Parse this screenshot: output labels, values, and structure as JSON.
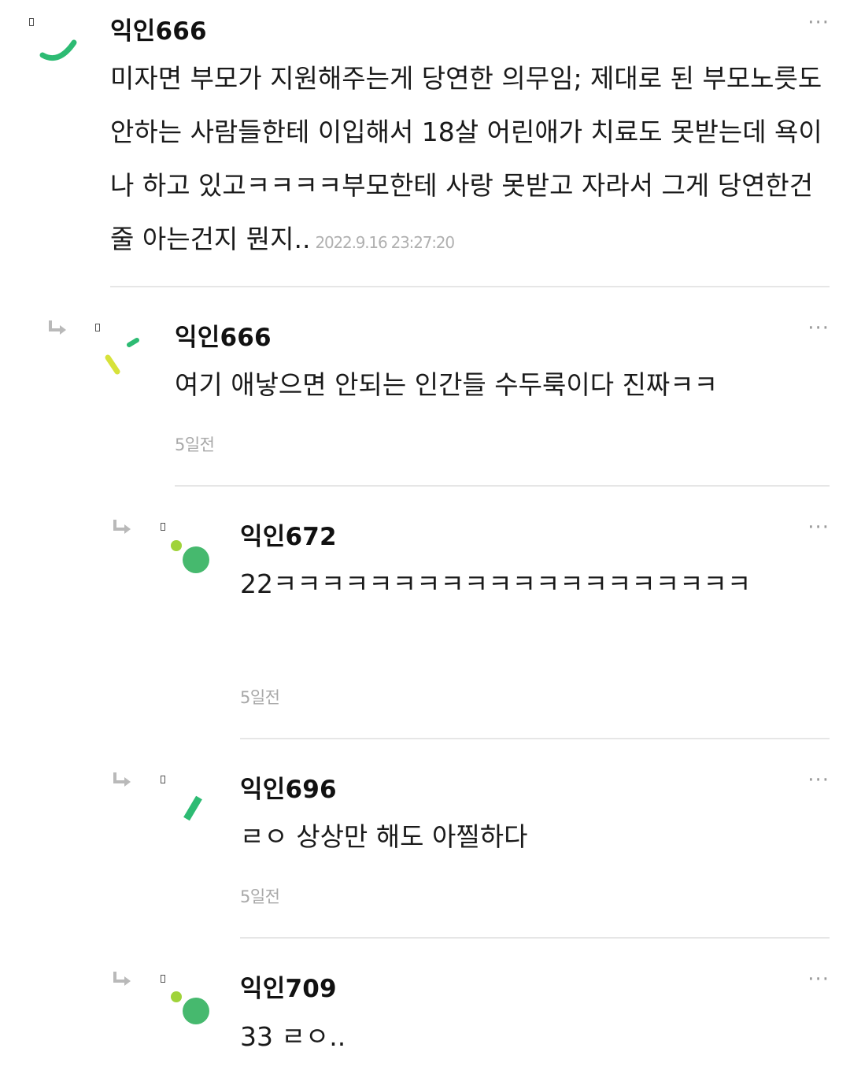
{
  "comments": [
    {
      "author": "익인666",
      "text": "미자면 부모가 지원해주는게 당연한 의무임; 제대로 된 부모노릇도 안하는 사람들한테 이입해서 18살 어린애가 치료도 못받는데 욕이나 하고 있고ㅋㅋㅋㅋ부모한테 사랑 못받고 자라서 그게 당연한건줄 아는건지 뭔지..",
      "time": "2022.9.16 23:27:20",
      "more": "···"
    },
    {
      "author": "익인666",
      "text": "여기 애낳으면 안되는 인간들 수두룩이다 진짜ㅋㅋ",
      "time": "5일전",
      "more": "···"
    },
    {
      "author": "익인672",
      "text": "22ㅋㅋㅋㅋㅋㅋㅋㅋㅋㅋㅋㅋㅋㅋㅋㅋㅋㅋㅋㅋ",
      "time": "5일전",
      "more": "···"
    },
    {
      "author": "익인696",
      "text": "ㄹㅇ 상상만 해도 아찔하다",
      "time": "5일전",
      "more": "···"
    },
    {
      "author": "익인709",
      "text": "33 ㄹㅇ..",
      "more": "···"
    }
  ],
  "icons": {
    "reply": "reply-arrow-icon",
    "more": "more-options-icon"
  },
  "colors": {
    "accent_green": "#2dbb73",
    "lime": "#9fd33a",
    "divider": "#e6e6e6",
    "time_gray": "#a8a8a8"
  }
}
